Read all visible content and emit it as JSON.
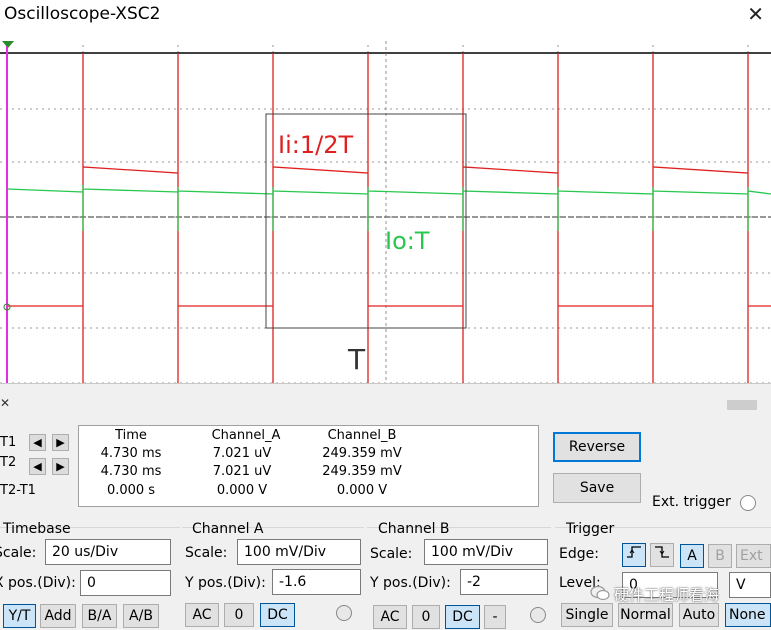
{
  "window": {
    "title": "Oscilloscope-XSC2"
  },
  "annotations": {
    "channel_a_note": "Ii:1/2T",
    "channel_b_note": "Io:T",
    "period_label": "T"
  },
  "colors": {
    "channel_a": "#e02020",
    "channel_b": "#28c850",
    "grid": "#555555",
    "cursor": "#e030e0"
  },
  "cursors": {
    "t1_label": "T1",
    "t2_label": "T2",
    "diff_label": "T2-T1",
    "headers": {
      "time": "Time",
      "channel_a": "Channel_A",
      "channel_b": "Channel_B"
    },
    "rows": [
      {
        "time": "4.730 ms",
        "channel_a": "7.021 uV",
        "channel_b": "249.359 mV"
      },
      {
        "time": "4.730 ms",
        "channel_a": "7.021 uV",
        "channel_b": "249.359 mV"
      },
      {
        "time": "0.000 s",
        "channel_a": "0.000 V",
        "channel_b": "0.000 V"
      }
    ]
  },
  "buttons": {
    "reverse": "Reverse",
    "save": "Save",
    "ext_trigger": "Ext. trigger"
  },
  "timebase": {
    "title": "Timebase",
    "scale_label": "Scale:",
    "scale_value": "20 us/Div",
    "xpos_label": "X pos.(Div):",
    "xpos_value": "0",
    "modes": [
      "Y/T",
      "Add",
      "B/A",
      "A/B"
    ]
  },
  "channel_a": {
    "title": "Channel A",
    "scale_label": "Scale:",
    "scale_value": "100 mV/Div",
    "ypos_label": "Y pos.(Div):",
    "ypos_value": "-1.6",
    "coupling": [
      "AC",
      "0",
      "DC"
    ]
  },
  "channel_b": {
    "title": "Channel B",
    "scale_label": "Scale:",
    "scale_value": "100 mV/Div",
    "ypos_label": "Y pos.(Div):",
    "ypos_value": "-2",
    "coupling": [
      "AC",
      "0",
      "DC",
      "-"
    ]
  },
  "trigger": {
    "title": "Trigger",
    "edge_label": "Edge:",
    "level_label": "Level:",
    "level_value": "0",
    "level_unit": "V",
    "sources": [
      "A",
      "B",
      "Ext"
    ],
    "modes": [
      "Single",
      "Normal",
      "Auto",
      "None"
    ]
  },
  "watermark": "硬件工程师看海"
}
